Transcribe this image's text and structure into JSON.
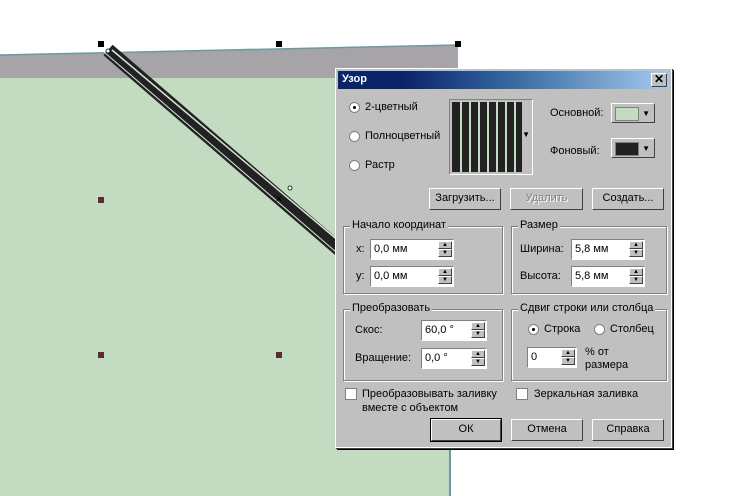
{
  "colors": {
    "fill": "#c2dbc1",
    "band": "#a6a4a8",
    "dark": "#222222",
    "foreground_swatch": "#c2dbc1",
    "background_swatch": "#222222"
  },
  "dialog": {
    "title": "Узор",
    "close": "✕",
    "mode": {
      "two_color": "2-цветный",
      "full_color": "Полноцветный",
      "bitmap": "Растр",
      "selected": "2-цветный"
    },
    "foreground_label": "Основной:",
    "background_label": "Фоновый:",
    "load_button": "Загрузить...",
    "delete_button": "Удалить",
    "create_button": "Создать...",
    "origin": {
      "title": "Начало координат",
      "x_label": "x:",
      "x_value": "0,0 мм",
      "y_label": "y:",
      "y_value": "0,0 мм"
    },
    "size": {
      "title": "Размер",
      "width_label": "Ширина:",
      "width_value": "5,8 мм",
      "height_label": "Высота:",
      "height_value": "5,8 мм"
    },
    "transform": {
      "title": "Преобразовать",
      "skew_label": "Скос:",
      "skew_value": "60,0 °",
      "rotate_label": "Вращение:",
      "rotate_value": "0,0 °"
    },
    "offset": {
      "title": "Сдвиг строки или столбца",
      "row": "Строка",
      "column": "Столбец",
      "value": "0",
      "percent_label_1": "% от",
      "percent_label_2": "размера"
    },
    "transform_fill_1": "Преобразовывать заливку",
    "transform_fill_2": "вместе с объектом",
    "mirror_fill": "Зеркальная заливка",
    "ok": "ОК",
    "cancel": "Отмена",
    "help": "Справка"
  }
}
